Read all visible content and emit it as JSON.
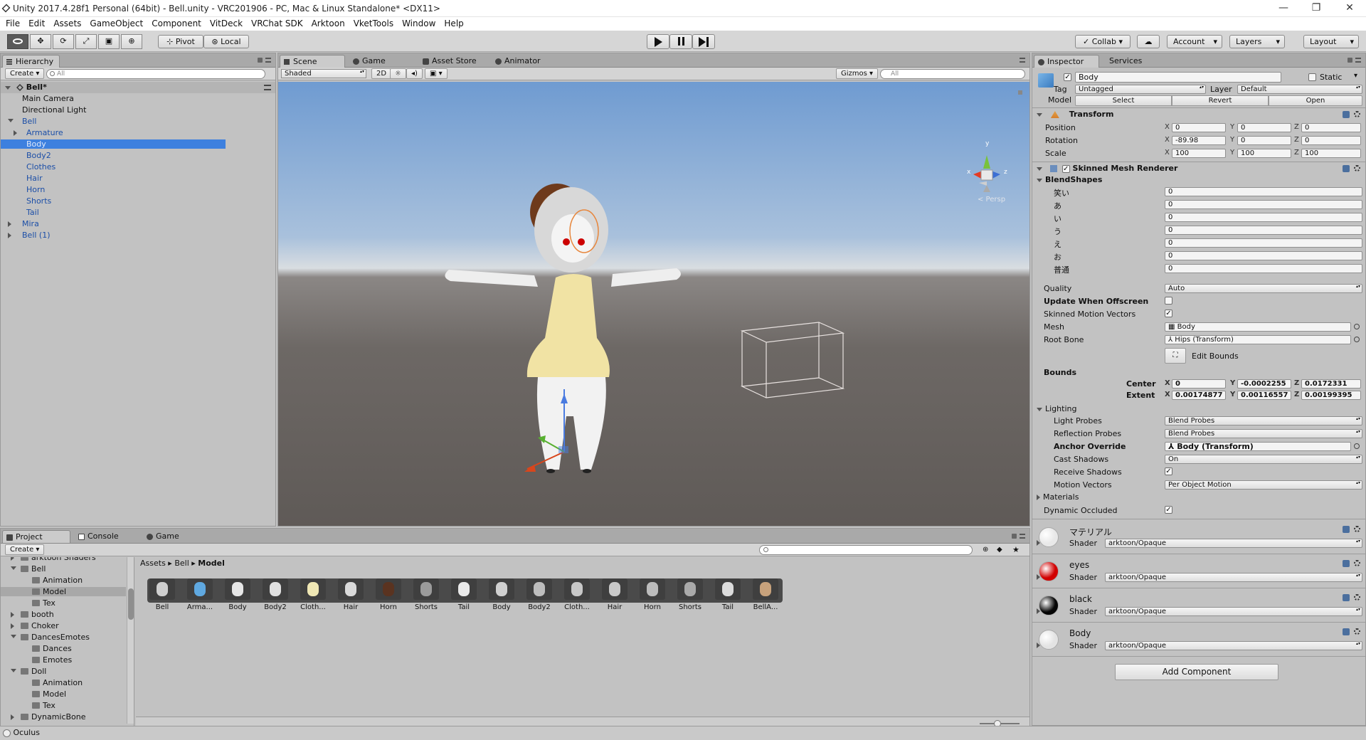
{
  "window": {
    "title": "Unity 2017.4.28f1 Personal (64bit) - Bell.unity - VRC201906 - PC, Mac & Linux Standalone* <DX11>",
    "controls": [
      "—",
      "❐",
      "✕"
    ]
  },
  "menu": [
    "File",
    "Edit",
    "Assets",
    "GameObject",
    "Component",
    "VitDeck",
    "VRChat SDK",
    "Arktoon",
    "VketTools",
    "Window",
    "Help"
  ],
  "toolbar": {
    "pivot": "Pivot",
    "local": "Local",
    "collab": "Collab ▾",
    "account": "Account",
    "layers": "Layers",
    "layout": "Layout"
  },
  "hierarchy": {
    "tab": "Hierarchy",
    "create": "Create ▾",
    "search_placeholder": "All",
    "scene": "Bell*",
    "rows": [
      {
        "label": "Main Camera",
        "indent": 0,
        "blue": false,
        "arrow": "",
        "selected": false
      },
      {
        "label": "Directional Light",
        "indent": 0,
        "blue": false,
        "arrow": "",
        "selected": false
      },
      {
        "label": "Bell",
        "indent": 0,
        "blue": true,
        "arrow": "down",
        "selected": false
      },
      {
        "label": "Armature",
        "indent": 1,
        "blue": true,
        "arrow": "right",
        "selected": false
      },
      {
        "label": "Body",
        "indent": 1,
        "blue": true,
        "arrow": "",
        "selected": true
      },
      {
        "label": "Body2",
        "indent": 1,
        "blue": true,
        "arrow": "",
        "selected": false
      },
      {
        "label": "Clothes",
        "indent": 1,
        "blue": true,
        "arrow": "",
        "selected": false
      },
      {
        "label": "Hair",
        "indent": 1,
        "blue": true,
        "arrow": "",
        "selected": false
      },
      {
        "label": "Horn",
        "indent": 1,
        "blue": true,
        "arrow": "",
        "selected": false
      },
      {
        "label": "Shorts",
        "indent": 1,
        "blue": true,
        "arrow": "",
        "selected": false
      },
      {
        "label": "Tail",
        "indent": 1,
        "blue": true,
        "arrow": "",
        "selected": false
      },
      {
        "label": "Mira",
        "indent": 0,
        "blue": true,
        "arrow": "right",
        "selected": false
      },
      {
        "label": "Bell (1)",
        "indent": 0,
        "blue": true,
        "arrow": "right",
        "selected": false
      }
    ]
  },
  "scene_tabs": [
    {
      "label": "Scene",
      "active": true
    },
    {
      "label": "Game",
      "active": false
    },
    {
      "label": "Asset Store",
      "active": false
    },
    {
      "label": "Animator",
      "active": false
    }
  ],
  "scene_bar": {
    "shading": "Shaded",
    "mode2d": "2D",
    "gizmos": "Gizmos",
    "search_placeholder": "All",
    "persp": "< Persp",
    "axes": [
      "y",
      "x",
      "z"
    ]
  },
  "bottom_tabs": [
    {
      "label": "Project",
      "active": true
    },
    {
      "label": "Console",
      "active": false
    },
    {
      "label": "Game",
      "active": false
    }
  ],
  "project": {
    "create": "Create ▾",
    "breadcrumb": [
      "Assets",
      "Bell",
      "Model"
    ],
    "tree": [
      {
        "label": "arktoon Shaders",
        "indent": 1,
        "arrow": "right",
        "selected": false
      },
      {
        "label": "Bell",
        "indent": 1,
        "arrow": "down",
        "selected": false
      },
      {
        "label": "Animation",
        "indent": 2,
        "arrow": "",
        "selected": false
      },
      {
        "label": "Model",
        "indent": 2,
        "arrow": "",
        "selected": true
      },
      {
        "label": "Tex",
        "indent": 2,
        "arrow": "",
        "selected": false
      },
      {
        "label": "booth",
        "indent": 1,
        "arrow": "right",
        "selected": false
      },
      {
        "label": "Choker",
        "indent": 1,
        "arrow": "right",
        "selected": false
      },
      {
        "label": "DancesEmotes",
        "indent": 1,
        "arrow": "down",
        "selected": false
      },
      {
        "label": "Dances",
        "indent": 2,
        "arrow": "",
        "selected": false
      },
      {
        "label": "Emotes",
        "indent": 2,
        "arrow": "",
        "selected": false
      },
      {
        "label": "Doll",
        "indent": 1,
        "arrow": "down",
        "selected": false
      },
      {
        "label": "Animation",
        "indent": 2,
        "arrow": "",
        "selected": false
      },
      {
        "label": "Model",
        "indent": 2,
        "arrow": "",
        "selected": false
      },
      {
        "label": "Tex",
        "indent": 2,
        "arrow": "",
        "selected": false
      },
      {
        "label": "DynamicBone",
        "indent": 1,
        "arrow": "right",
        "selected": false
      }
    ],
    "assets": [
      {
        "label": "Bell",
        "color": "#cfcfcf"
      },
      {
        "label": "Arma...",
        "color": "#5fa8e0"
      },
      {
        "label": "Body",
        "color": "#e6e6e6"
      },
      {
        "label": "Body2",
        "color": "#e0e0e0"
      },
      {
        "label": "Cloth...",
        "color": "#efe7b4"
      },
      {
        "label": "Hair",
        "color": "#d9d9d9"
      },
      {
        "label": "Horn",
        "color": "#5a3320"
      },
      {
        "label": "Shorts",
        "color": "#9b9b9b"
      },
      {
        "label": "Tail",
        "color": "#e9e9e9"
      },
      {
        "label": "Body",
        "color": "#cfcfcf"
      },
      {
        "label": "Body2",
        "color": "#bdbdbd"
      },
      {
        "label": "Cloth...",
        "color": "#c7c7c7"
      },
      {
        "label": "Hair",
        "color": "#c9c9c9"
      },
      {
        "label": "Horn",
        "color": "#bcbcbc"
      },
      {
        "label": "Shorts",
        "color": "#a9a9a9"
      },
      {
        "label": "Tail",
        "color": "#dcdcdc"
      },
      {
        "label": "BellA...",
        "color": "#c7a27c"
      }
    ]
  },
  "status": {
    "text": "Oculus"
  },
  "inspector": {
    "tabs": [
      {
        "label": "Inspector",
        "active": true
      },
      {
        "label": "Services",
        "active": false
      }
    ],
    "name": "Body",
    "static": "Static",
    "tag_label": "Tag",
    "tag_value": "Untagged",
    "layer_label": "Layer",
    "layer_value": "Default",
    "model_label": "Model",
    "model_buttons": [
      "Select",
      "Revert",
      "Open"
    ],
    "transform": {
      "title": "Transform",
      "position_label": "Position",
      "rotation_label": "Rotation",
      "scale_label": "Scale",
      "position": [
        "0",
        "0",
        "0"
      ],
      "rotation": [
        "-89.98",
        "0",
        "0"
      ],
      "scale": [
        "100",
        "100",
        "100"
      ]
    },
    "smr": {
      "title": "Skinned Mesh Renderer",
      "blend_title": "BlendShapes",
      "blendshapes": [
        {
          "name": "笑い",
          "value": "0"
        },
        {
          "name": "あ",
          "value": "0"
        },
        {
          "name": "い",
          "value": "0"
        },
        {
          "name": "う",
          "value": "0"
        },
        {
          "name": "え",
          "value": "0"
        },
        {
          "name": "お",
          "value": "0"
        },
        {
          "name": "普通",
          "value": "0"
        }
      ],
      "quality_label": "Quality",
      "quality_value": "Auto",
      "update_offscreen_label": "Update When Offscreen",
      "skinned_motion_label": "Skinned Motion Vectors",
      "mesh_label": "Mesh",
      "mesh_value": "Body",
      "root_bone_label": "Root Bone",
      "root_bone_value": "Hips (Transform)",
      "edit_bounds": "Edit Bounds",
      "bounds_label": "Bounds",
      "center_label": "Center",
      "extent_label": "Extent",
      "center": [
        "0",
        "-0.0002255",
        "0.0172331"
      ],
      "extent": [
        "0.00174877",
        "0.00116557",
        "0.00199395"
      ],
      "lighting_label": "Lighting",
      "light_probes_label": "Light Probes",
      "light_probes_value": "Blend Probes",
      "reflection_label": "Reflection Probes",
      "reflection_value": "Blend Probes",
      "anchor_label": "Anchor Override",
      "anchor_value": "Body (Transform)",
      "cast_label": "Cast Shadows",
      "cast_value": "On",
      "receive_label": "Receive Shadows",
      "motion_label": "Motion Vectors",
      "motion_value": "Per Object Motion",
      "materials_label": "Materials",
      "dynamic_label": "Dynamic Occluded"
    },
    "materials": [
      {
        "name": "マテリアル",
        "shader": "arktoon/Opaque",
        "color": "#e8e8e8"
      },
      {
        "name": "eyes",
        "shader": "arktoon/Opaque",
        "color": "#d10000"
      },
      {
        "name": "black",
        "shader": "arktoon/Opaque",
        "color": "#050505"
      },
      {
        "name": "Body",
        "shader": "arktoon/Opaque",
        "color": "#e3e3e3"
      }
    ],
    "shader_label": "Shader",
    "add_component": "Add Component"
  }
}
